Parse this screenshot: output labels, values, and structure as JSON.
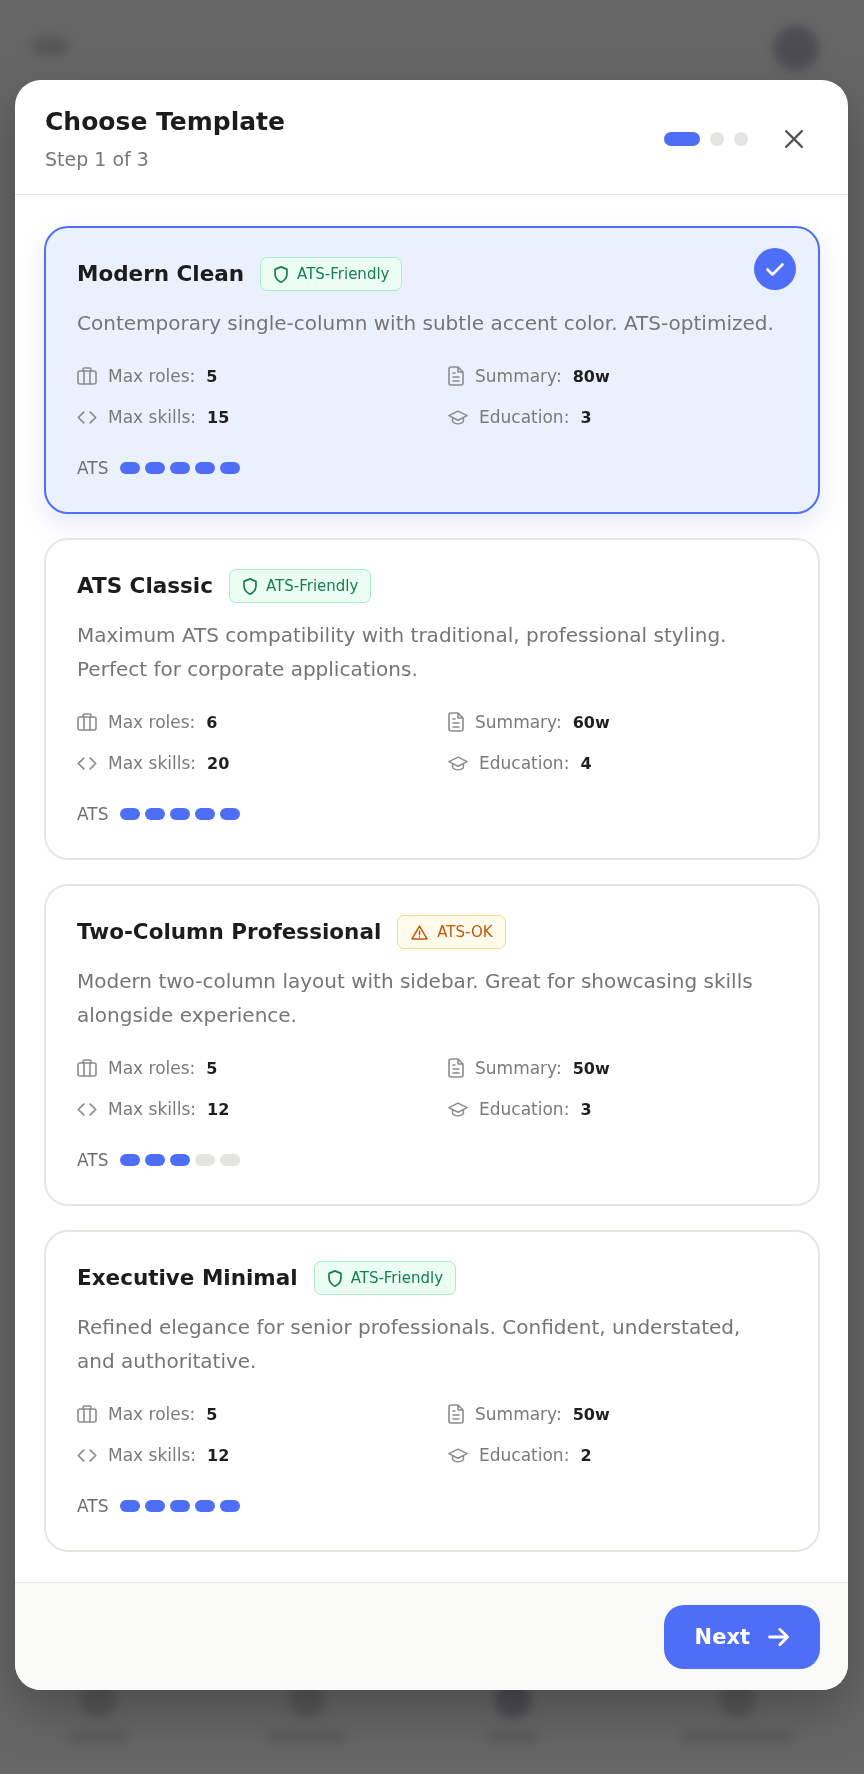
{
  "dialog": {
    "title": "Choose Template",
    "subtitle": "Step 1 of 3",
    "steps": [
      {
        "selected": true
      },
      {
        "selected": false
      },
      {
        "selected": false
      }
    ]
  },
  "templates": [
    {
      "name": "Modern Clean",
      "selected": true,
      "badge": {
        "kind": "friendly",
        "label": "ATS-Friendly"
      },
      "description": "Contemporary single-column with subtle accent color. ATS-optimized.",
      "stats": [
        {
          "kind": "roles",
          "label": "Max roles:",
          "value": "5"
        },
        {
          "kind": "summary",
          "label": "Summary:",
          "value": "80w"
        },
        {
          "kind": "skills",
          "label": "Max skills:",
          "value": "15"
        },
        {
          "kind": "education",
          "label": "Education:",
          "value": "3"
        }
      ],
      "ats": {
        "label": "ATS",
        "stars": 5
      }
    },
    {
      "name": "ATS Classic",
      "selected": false,
      "badge": {
        "kind": "friendly",
        "label": "ATS-Friendly"
      },
      "description": "Maximum ATS compatibility with traditional, professional styling. Perfect for corporate applications.",
      "stats": [
        {
          "kind": "roles",
          "label": "Max roles:",
          "value": "6"
        },
        {
          "kind": "summary",
          "label": "Summary:",
          "value": "60w"
        },
        {
          "kind": "skills",
          "label": "Max skills:",
          "value": "20"
        },
        {
          "kind": "education",
          "label": "Education:",
          "value": "4"
        }
      ],
      "ats": {
        "label": "ATS",
        "stars": 5
      }
    },
    {
      "name": "Two-Column Professional",
      "selected": false,
      "badge": {
        "kind": "ok",
        "label": "ATS-OK"
      },
      "description": "Modern two-column layout with sidebar. Great for showcasing skills alongside experience.",
      "stats": [
        {
          "kind": "roles",
          "label": "Max roles:",
          "value": "5"
        },
        {
          "kind": "summary",
          "label": "Summary:",
          "value": "50w"
        },
        {
          "kind": "skills",
          "label": "Max skills:",
          "value": "12"
        },
        {
          "kind": "education",
          "label": "Education:",
          "value": "3"
        }
      ],
      "ats": {
        "label": "ATS",
        "stars": 3
      }
    },
    {
      "name": "Executive Minimal",
      "selected": false,
      "badge": {
        "kind": "friendly",
        "label": "ATS-Friendly"
      },
      "description": "Refined elegance for senior professionals. Confident, understated, and authoritative.",
      "stats": [
        {
          "kind": "roles",
          "label": "Max roles:",
          "value": "5"
        },
        {
          "kind": "summary",
          "label": "Summary:",
          "value": "50w"
        },
        {
          "kind": "skills",
          "label": "Max skills:",
          "value": "12"
        },
        {
          "kind": "education",
          "label": "Education:",
          "value": "2"
        }
      ],
      "ats": {
        "label": "ATS",
        "stars": 5
      }
    }
  ],
  "footer": {
    "next_button": "Next"
  }
}
